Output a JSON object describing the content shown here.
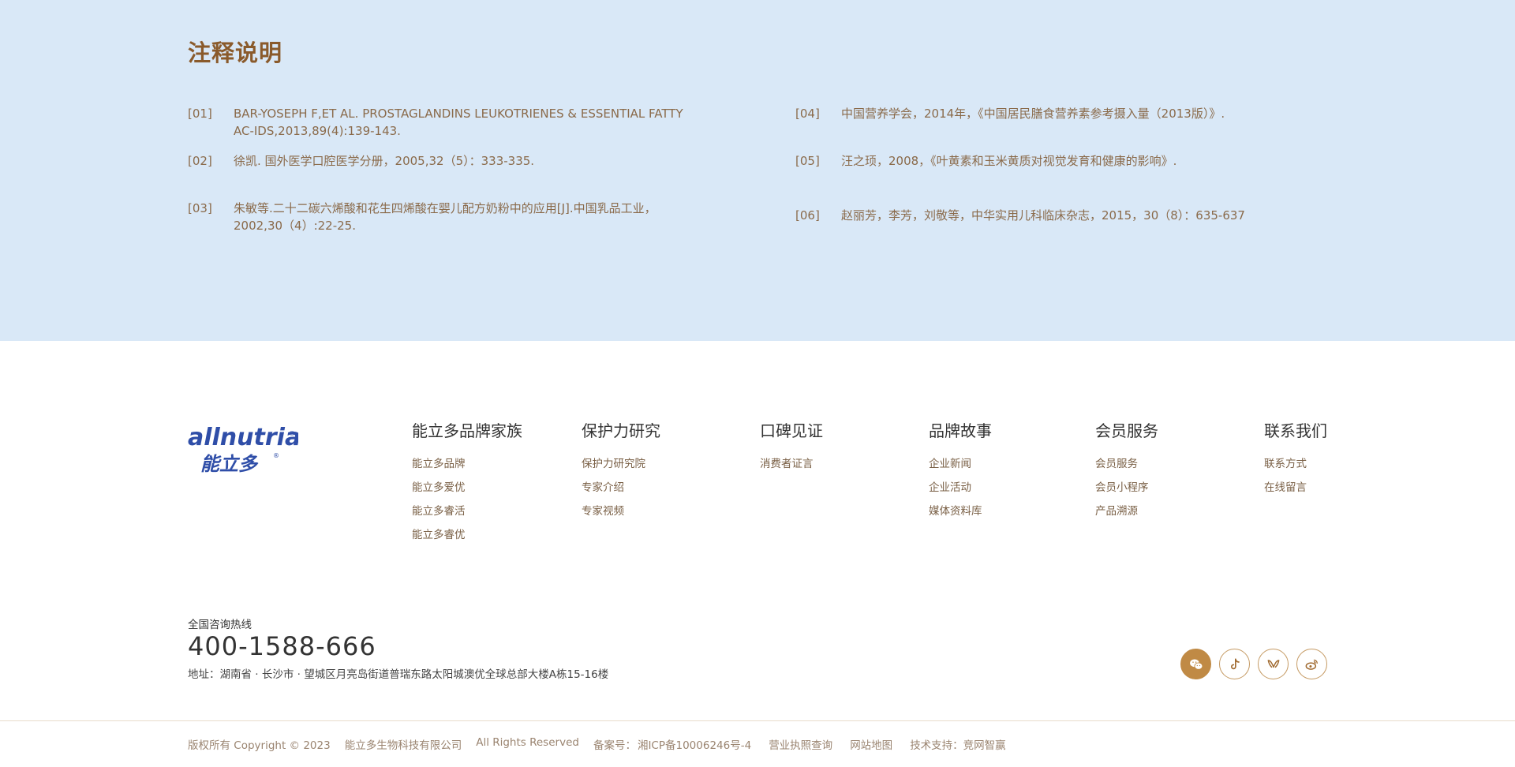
{
  "notes": {
    "title": "注释说明",
    "refs": [
      {
        "num": "[01]",
        "text": "BAR-YOSEPH F,ET AL. PROSTAGLANDINS LEUKOTRIENES & ESSENTIAL FATTY AC-IDS,2013,89(4):139-143."
      },
      {
        "num": "[02]",
        "text": "徐凯. 国外医学口腔医学分册，2005,32（5）：333-335."
      },
      {
        "num": "[03]",
        "text": "朱敏等.二十二碳六烯酸和花生四烯酸在婴儿配方奶粉中的应用[J].中国乳品工业，2002,30（4）:22-25."
      },
      {
        "num": "[04]",
        "text": "中国营养学会，2014年，《中国居民膳食营养素参考摄入量（2013版）》."
      },
      {
        "num": "[05]",
        "text": "汪之顼，2008，《叶黄素和玉米黄质对视觉发育和健康的影响》."
      },
      {
        "num": "[06]",
        "text": "赵丽芳，李芳，刘敬等，中华实用儿科临床杂志，2015，30（8）：635-637"
      }
    ]
  },
  "logo": {
    "wordmark": "allnutria",
    "cn": "能立多"
  },
  "footer_nav": [
    {
      "title": "能立多品牌家族",
      "links": [
        "能立多品牌",
        "能立多爱优",
        "能立多睿活",
        "能立多睿优"
      ]
    },
    {
      "title": "保护力研究",
      "links": [
        "保护力研究院",
        "专家介绍",
        "专家视频"
      ]
    },
    {
      "title": "口碑见证",
      "links": [
        "消费者证言"
      ]
    },
    {
      "title": "品牌故事",
      "links": [
        "企业新闻",
        "企业活动",
        "媒体资料库"
      ]
    },
    {
      "title": "会员服务",
      "links": [
        "会员服务",
        "会员小程序",
        "产品溯源"
      ]
    },
    {
      "title": "联系我们",
      "links": [
        "联系方式",
        "在线留言"
      ]
    }
  ],
  "contact": {
    "hotline_label": "全国咨询热线",
    "hotline": "400-1588-666",
    "address": "地址：湖南省 · 长沙市 · 望城区月亮岛街道普瑞东路太阳城澳优全球总部大楼A栋15-16楼"
  },
  "socials": [
    "wechat-icon",
    "douyin-icon",
    "xiaohongshu-icon",
    "weibo-icon"
  ],
  "copyright": {
    "rights": "版权所有 Copyright © 2023",
    "company": "能立多生物科技有限公司",
    "reserved": "All Rights Reserved",
    "icp_label": "备案号：",
    "icp": "湘ICP备10006246号-4",
    "license": "营业执照查询",
    "sitemap": "网站地图",
    "tech": "技术支持：竞网智赢"
  },
  "colors": {
    "notes_bg": "#d9e8f7",
    "brand_brown": "#8a5a2b",
    "accent_gold": "#c08a45",
    "logo_blue": "#2f4ea8"
  }
}
